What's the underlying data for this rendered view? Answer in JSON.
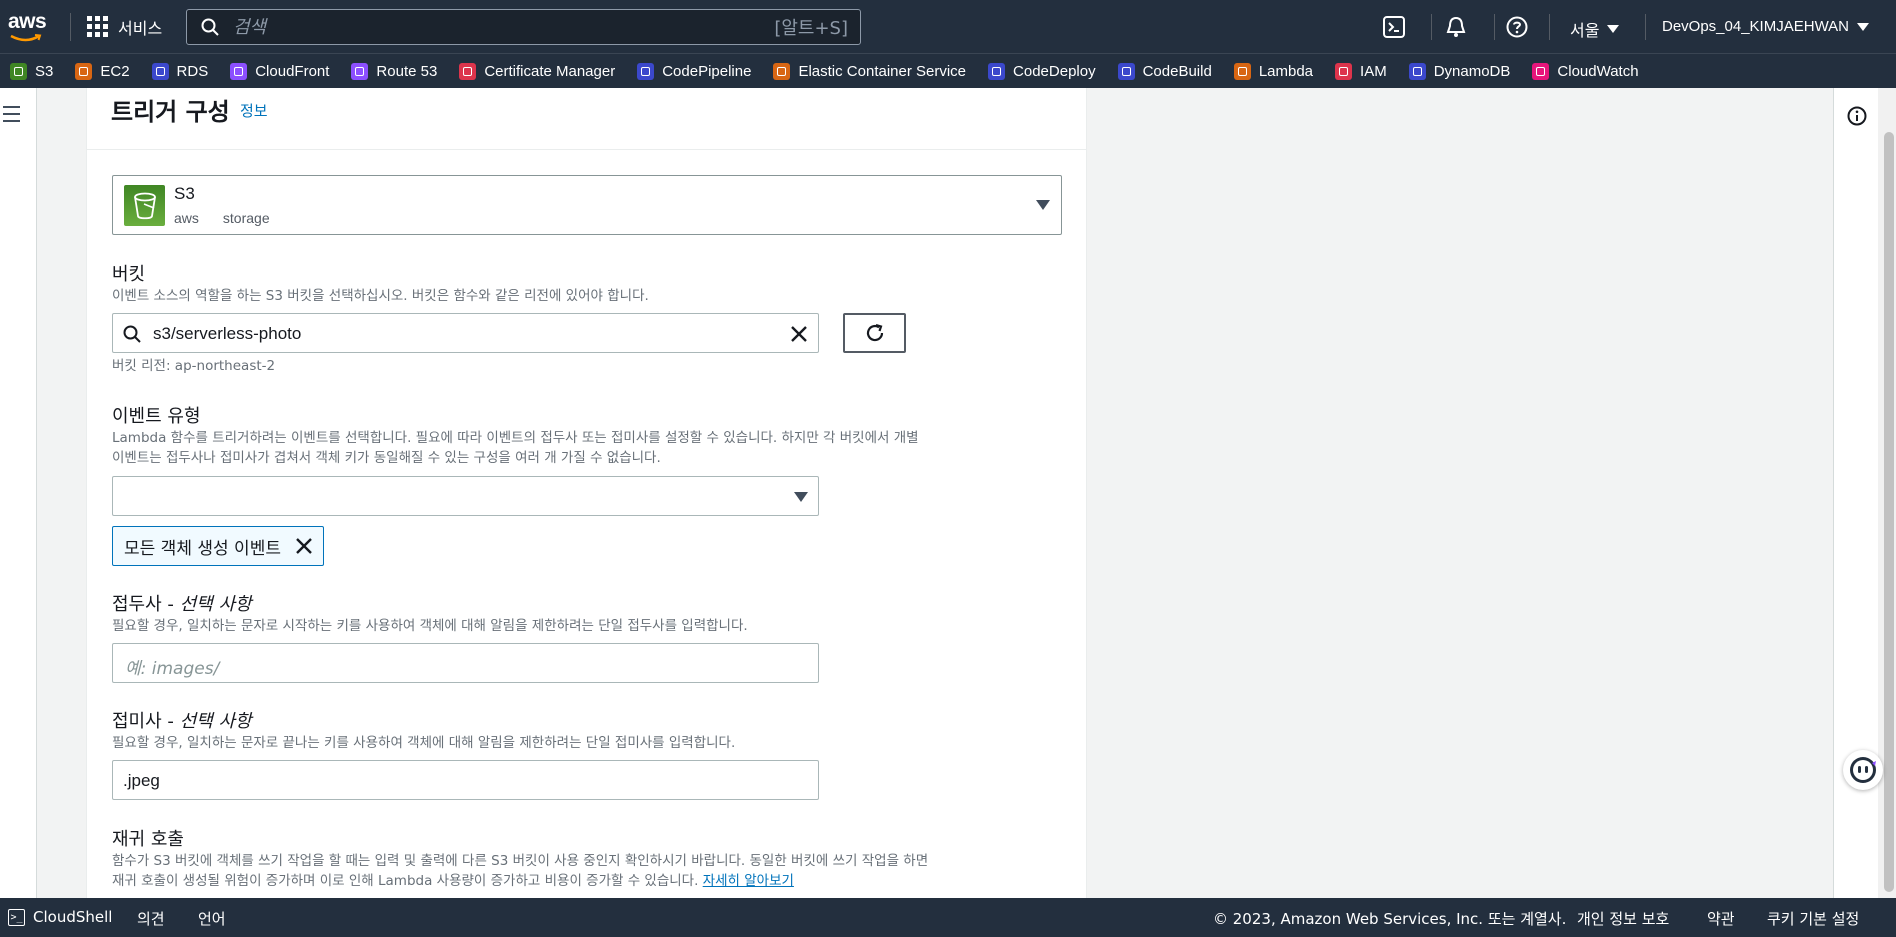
{
  "topnav": {
    "logo_text": "aws",
    "services_label": "서비스",
    "search_placeholder": "검색",
    "search_shortcut": "[알트+S]",
    "region": "서울",
    "account": "DevOps_04_KIMJAEHWAN"
  },
  "favorites": [
    {
      "label": "S3",
      "color": "#3f8624"
    },
    {
      "label": "EC2",
      "color": "#d86613"
    },
    {
      "label": "RDS",
      "color": "#3b48cc"
    },
    {
      "label": "CloudFront",
      "color": "#8c4fff"
    },
    {
      "label": "Route 53",
      "color": "#8c4fff"
    },
    {
      "label": "Certificate Manager",
      "color": "#dd344c"
    },
    {
      "label": "CodePipeline",
      "color": "#3b48cc"
    },
    {
      "label": "Elastic Container Service",
      "color": "#d86613"
    },
    {
      "label": "CodeDeploy",
      "color": "#3b48cc"
    },
    {
      "label": "CodeBuild",
      "color": "#3b48cc"
    },
    {
      "label": "Lambda",
      "color": "#d86613"
    },
    {
      "label": "IAM",
      "color": "#dd344c"
    },
    {
      "label": "DynamoDB",
      "color": "#3b48cc"
    },
    {
      "label": "CloudWatch",
      "color": "#e7157b"
    }
  ],
  "panel": {
    "title": "트리거 구성",
    "info_link": "정보",
    "source": {
      "name": "S3",
      "tag1": "aws",
      "tag2": "storage"
    },
    "bucket": {
      "label": "버킷",
      "description": "이벤트 소스의 역할을 하는 S3 버킷을 선택하십시오. 버킷은 함수와 같은 리전에 있어야 합니다.",
      "value": "s3/serverless-photo",
      "region_note": "버킷 리전: ap-northeast-2"
    },
    "event_type": {
      "label": "이벤트 유형",
      "description_line1": "Lambda 함수를 트리거하려는 이벤트를 선택합니다. 필요에 따라 이벤트의 접두사 또는 접미사를 설정할 수 있습니다. 하지만 각 버킷에서 개별",
      "description_line2": "이벤트는 접두사나 접미사가 겹쳐서 객체 키가 동일해질 수 있는 구성을 여러 개 가질 수 없습니다.",
      "selected_token": "모든 객체 생성 이벤트"
    },
    "prefix": {
      "label": "접두사 - ",
      "optional": "선택 사항",
      "description": "필요할 경우, 일치하는 문자로 시작하는 키를 사용하여 객체에 대해 알림을 제한하려는 단일 접두사를 입력합니다.",
      "placeholder": "예: images/"
    },
    "suffix": {
      "label": "접미사 - ",
      "optional": "선택 사항",
      "description": "필요할 경우, 일치하는 문자로 끝나는 키를 사용하여 객체에 대해 알림을 제한하려는 단일 접미사를 입력합니다.",
      "value": ".jpeg"
    },
    "recursive": {
      "label": "재귀 호출",
      "description_line1": "함수가 S3 버킷에 객체를 쓰기 작업을 할 때는 입력 및 출력에 다른 S3 버킷이 사용 중인지 확인하시기 바랍니다. 동일한 버킷에 쓰기 작업을 하면",
      "description_line2": "재귀 호출이 생성될 위험이 증가하며 이로 인해 Lambda 사용량이 증가하고 비용이 증가할 수 있습니다. ",
      "learn_more": "자세히 알아보기"
    }
  },
  "footer": {
    "cloudshell": "CloudShell",
    "feedback": "의견",
    "language": "언어",
    "copyright": "© 2023, Amazon Web Services, Inc. 또는 계열사.",
    "privacy": "개인 정보 보호",
    "terms": "약관",
    "cookies": "쿠키 기본 설정"
  },
  "colors": {
    "nav_bg": "#232f3e",
    "link": "#0073bb",
    "accent_orange": "#ff9900"
  }
}
